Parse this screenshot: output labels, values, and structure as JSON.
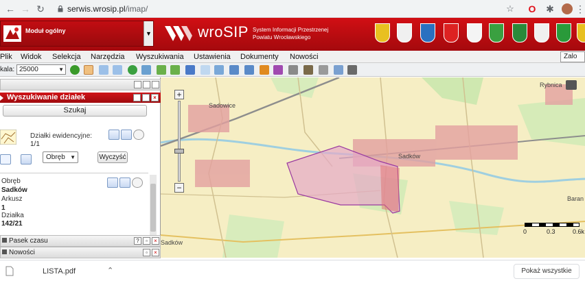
{
  "browser": {
    "url_domain": "serwis.wrosip.pl",
    "url_path": "/imap/"
  },
  "header": {
    "module": "Moduł ogólny",
    "brand": "wroSIP",
    "subtitle_line1": "System Informacji Przestrzenej",
    "subtitle_line2": "Powiatu Wrocławskiego"
  },
  "menu": {
    "items": [
      "Plik",
      "Widok",
      "Selekcja",
      "Narzędzia",
      "Wyszukiwania",
      "Ustawienia",
      "Dokumenty",
      "Nowości"
    ],
    "logout": "Zalo"
  },
  "toolbar": {
    "scale_label": "kala:",
    "scale_value": "25000"
  },
  "search_panel": {
    "title": "Wyszukiwanie działek",
    "search_button": "Szukaj",
    "parcels_label": "Działki ewidencyjne:",
    "parcels_count": "1/1",
    "dropdown_value": "Obręb",
    "clear_button": "Wyczyść",
    "obreb_label": "Obręb",
    "obreb_value": "Sadków",
    "arkusz_label": "Arkusz",
    "arkusz_value": "1",
    "dzialka_label": "Działka",
    "dzialka_value": "142/21"
  },
  "panels": {
    "timeline": "Pasek czasu",
    "news": "Nowości"
  },
  "map": {
    "labels": [
      "Sadowice",
      "Sadków",
      "Sadków",
      "Rybnica",
      "Baran"
    ],
    "scale_ticks": [
      "0",
      "0.3",
      "0.6k"
    ]
  },
  "downloads": {
    "file": "LISTA.pdf",
    "show_all": "Pokaż wszystkie"
  },
  "colors": {
    "brand_red": "#c8101a",
    "parcel_fill": "#e6aac8",
    "map_bg": "#f6eec4"
  }
}
